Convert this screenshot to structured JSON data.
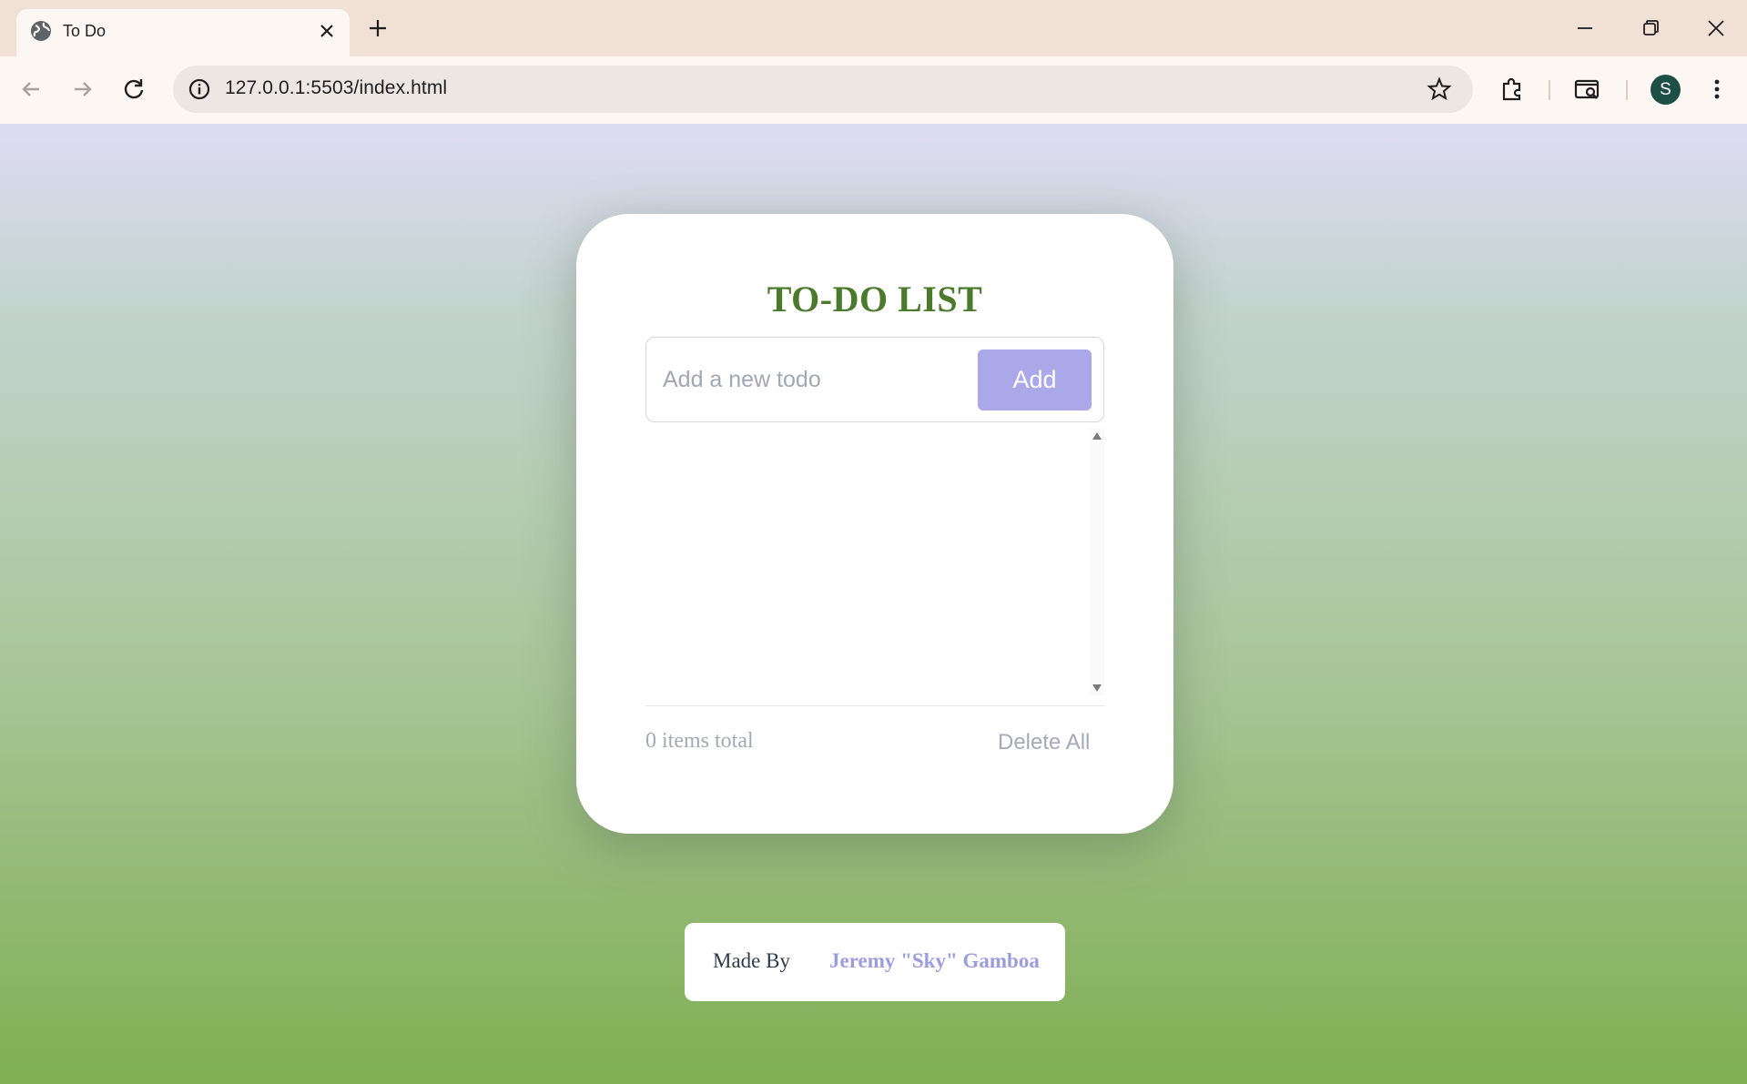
{
  "browser": {
    "tab_title": "To Do",
    "url": "127.0.0.1:5503/index.html",
    "profile_initial": "S"
  },
  "app": {
    "title": "TO-DO LIST",
    "input_placeholder": "Add a new todo",
    "input_value": "",
    "add_label": "Add",
    "items": [],
    "count_text": "0 items total",
    "delete_all_label": "Delete All"
  },
  "credit": {
    "label": "Made By",
    "author": "Jeremy \"Sky\" Gamboa"
  },
  "colors": {
    "title": "#4c7a2c",
    "add_button": "#aaa8e8",
    "muted_text": "#a5a9b6",
    "author_link": "#9e9ce0",
    "avatar": "#1d4f45"
  }
}
